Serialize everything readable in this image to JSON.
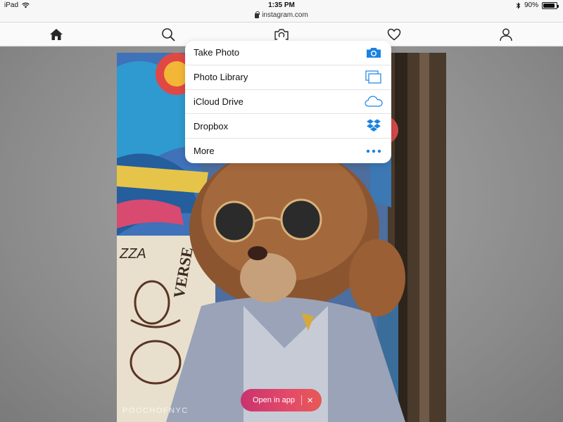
{
  "status_bar": {
    "device": "iPad",
    "time": "1:35 PM",
    "battery": "90%",
    "battery_level": 0.9
  },
  "url_bar": {
    "domain": "instagram.com"
  },
  "nav": {
    "items": [
      {
        "icon": "home-icon"
      },
      {
        "icon": "search-icon"
      },
      {
        "icon": "camera-icon"
      },
      {
        "icon": "heart-icon"
      },
      {
        "icon": "profile-icon"
      }
    ]
  },
  "photo": {
    "watermark": "POOCHOFNYC",
    "wall_text": "VERSE"
  },
  "action_sheet": {
    "items": [
      {
        "label": "Take Photo",
        "icon": "camera-icon"
      },
      {
        "label": "Photo Library",
        "icon": "photo-library-icon"
      },
      {
        "label": "iCloud Drive",
        "icon": "cloud-icon"
      },
      {
        "label": "Dropbox",
        "icon": "dropbox-icon"
      },
      {
        "label": "More",
        "icon": "more-dots-icon"
      }
    ],
    "accent_color": "#1a82e2"
  },
  "open_in_app": {
    "label": "Open in app",
    "close": "✕"
  }
}
